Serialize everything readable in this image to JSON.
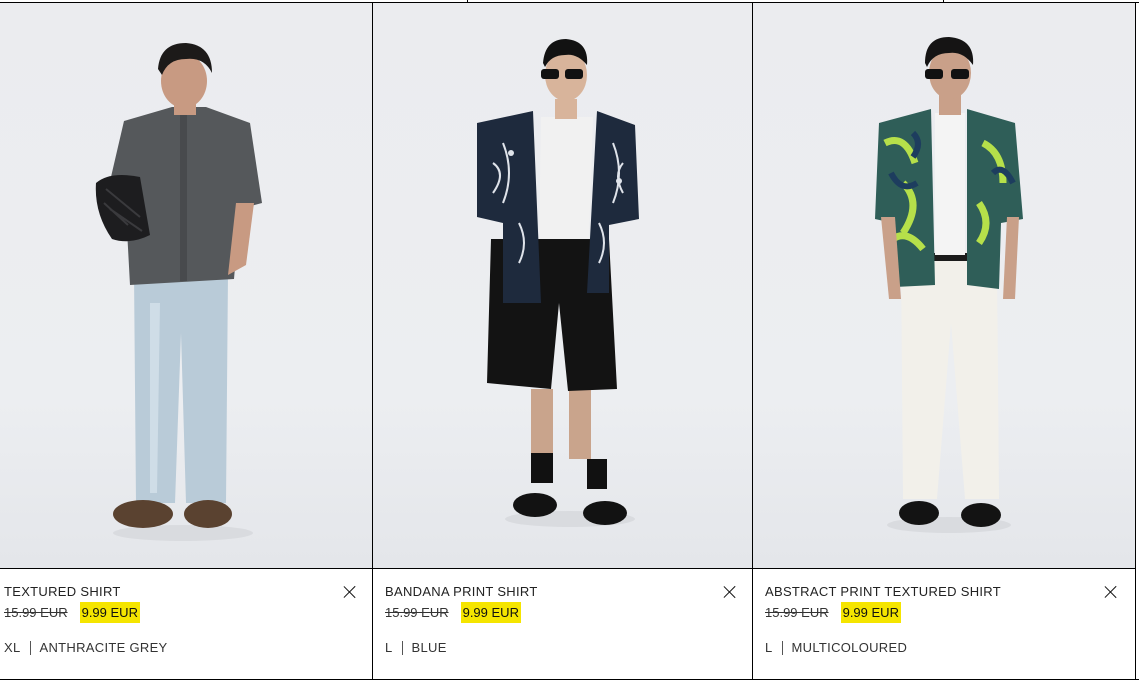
{
  "products": [
    {
      "name": "TEXTURED SHIRT",
      "old_price": "15.99 EUR",
      "new_price": "9.99 EUR",
      "size": "XL",
      "colour": "ANTHRACITE GREY"
    },
    {
      "name": "BANDANA PRINT SHIRT",
      "old_price": "15.99 EUR",
      "new_price": "9.99 EUR",
      "size": "L",
      "colour": "BLUE"
    },
    {
      "name": "ABSTRACT PRINT TEXTURED SHIRT",
      "old_price": "15.99 EUR",
      "new_price": "9.99 EUR",
      "size": "L",
      "colour": "MULTICOLOURED"
    }
  ],
  "colors": {
    "sale_highlight": "#f5e500",
    "photo_background": "#eceef1",
    "border": "#000000"
  },
  "icons": {
    "remove": "close-icon"
  }
}
